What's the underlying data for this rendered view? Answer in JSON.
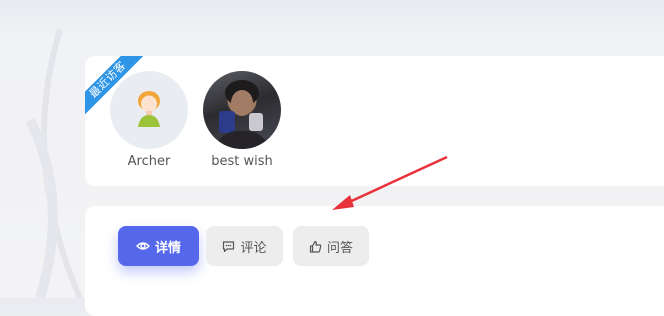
{
  "visitors_section": {
    "badge": "最近访客",
    "visitors": [
      {
        "name": "Archer",
        "avatar": "default-avatar-icon"
      },
      {
        "name": "best wish",
        "avatar": "photo-avatar"
      }
    ]
  },
  "tabs": [
    {
      "label": "详情",
      "icon": "eye-icon",
      "active": true
    },
    {
      "label": "评论",
      "icon": "comment-icon",
      "active": false
    },
    {
      "label": "问答",
      "icon": "thumbs-up-icon",
      "active": false
    }
  ],
  "colors": {
    "accent": "#5567ea",
    "ribbon": "#2f95e6",
    "annotation_arrow": "#e8323a"
  }
}
